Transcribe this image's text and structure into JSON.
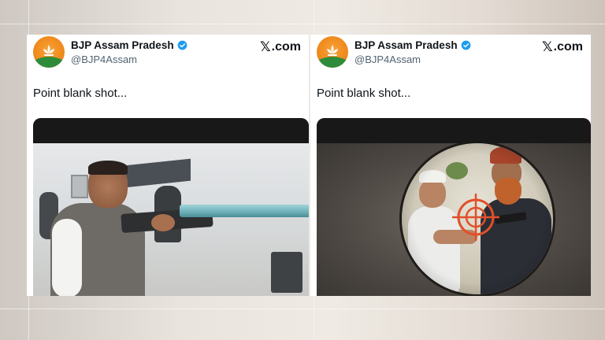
{
  "posts": [
    {
      "account_name": "BJP Assam Pradesh",
      "handle": "@BJP4Assam",
      "site_label": ".com",
      "site_glyph": "𝕏",
      "text": "Point blank shot..."
    },
    {
      "account_name": "BJP Assam Pradesh",
      "handle": "@BJP4Assam",
      "site_label": ".com",
      "site_glyph": "𝕏",
      "text": "Point blank shot..."
    }
  ],
  "colors": {
    "avatar_orange": "#f08a1c",
    "avatar_green": "#2e8b3a",
    "verified_blue": "#1d9bf0",
    "text_primary": "#0f1419",
    "text_secondary": "#536471",
    "crosshair_red": "#e0502a"
  },
  "icons": {
    "avatar": "bjp-lotus-logo",
    "verified": "verified-badge-icon",
    "site": "x-logo-icon",
    "crosshair": "crosshair-icon"
  }
}
